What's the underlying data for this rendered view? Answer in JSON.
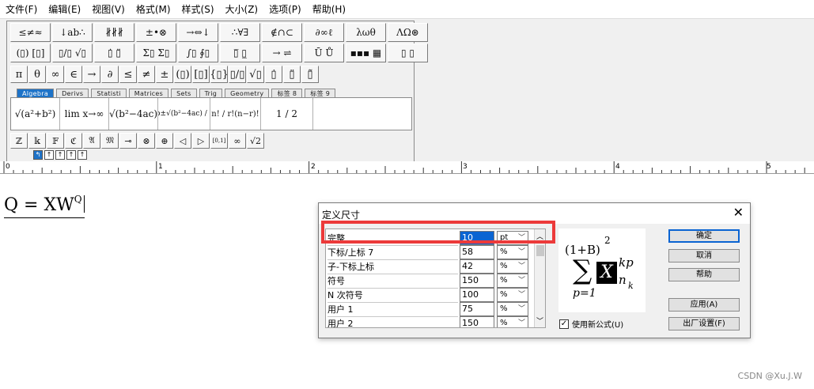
{
  "menu": [
    "文件(F)",
    "编辑(E)",
    "视图(V)",
    "格式(M)",
    "样式(S)",
    "大小(Z)",
    "选项(P)",
    "帮助(H)"
  ],
  "palette": {
    "row1": [
      "≤≠≈",
      "↓ab∴",
      "∦∦∦",
      "±•⊗",
      "→⇔↓",
      "∴∀∃",
      "∉∩⊂",
      "∂∞ℓ",
      "λωθ",
      "ΛΩ⊛"
    ],
    "row2": [
      "(▯) [▯]",
      "▯/▯ √▯",
      "▯̇ ▯̈",
      "Σ▯ Σ▯",
      "∫▯ ∮▯",
      "▯̅ ▯̲",
      "→ ⇌",
      "Ū Ů",
      "▪▪▪ ▦",
      "▯ ▯"
    ],
    "row3": [
      "π",
      "θ",
      "∞",
      "∈",
      "→",
      "∂",
      "≤",
      "≠",
      "±",
      "(▯)",
      "[▯]",
      "{▯}",
      "▯/▯",
      "√▯",
      "▯̇",
      "▯̈",
      "▯̃"
    ],
    "tabs": [
      "Algebra",
      "Derivs",
      "Statisti",
      "Matrices",
      "Sets",
      "Trig",
      "Geometry",
      "标签 8",
      "标签 9"
    ],
    "templates": [
      "√(a²+b²)",
      "lim x→∞",
      "√(b²−4ac)",
      "−b±√(b²−4ac) / 2a",
      "n! / r!(n−r)!",
      "1 / 2"
    ],
    "row5": [
      "ℤ",
      "𝕜",
      "𝔽",
      "ℭ",
      "𝔄",
      "𝔐",
      "⊸",
      "⊗",
      "⊕",
      "◁",
      "▷",
      "[0,1]",
      "∞",
      "√2"
    ],
    "nav": [
      "↰",
      "↑",
      "↑",
      "↑",
      "↑"
    ]
  },
  "ruler": {
    "labels": [
      "0",
      "1",
      "2",
      "3",
      "4",
      "5"
    ]
  },
  "editor": {
    "equation_main": "Q = XW",
    "equation_sup": "Q"
  },
  "dialog": {
    "title": "定义尺寸",
    "close_glyph": "✕",
    "rows": [
      {
        "label": "完整",
        "value": "10",
        "unit": "pt"
      },
      {
        "label": "下标/上标 7",
        "value": "58",
        "unit": "%"
      },
      {
        "label": "子-下标上标",
        "value": "42",
        "unit": "%"
      },
      {
        "label": "符号",
        "value": "150",
        "unit": "%"
      },
      {
        "label": "N 次符号",
        "value": "100",
        "unit": "%"
      },
      {
        "label": "用户 1",
        "value": "75",
        "unit": "%"
      },
      {
        "label": "用户 2",
        "value": "150",
        "unit": "%"
      }
    ],
    "buttons": {
      "ok": "确定",
      "cancel": "取消",
      "help": "帮助",
      "apply": "应用(A)",
      "factory": "出厂设置(F)"
    },
    "checkbox_label": "使用新公式(U)",
    "checkbox_mark": "✓",
    "preview": {
      "top": "(1+B)",
      "top_exp": "2",
      "sum": "∑",
      "var": "X",
      "sup": "kp",
      "sub": "n",
      "subsub": "k",
      "lower": "p=1"
    }
  },
  "watermark": "CSDN @Xu.J.W",
  "colors": {
    "highlight": "#ec3a3a",
    "accent": "#1e73c8",
    "selection": "#0a64d2"
  }
}
